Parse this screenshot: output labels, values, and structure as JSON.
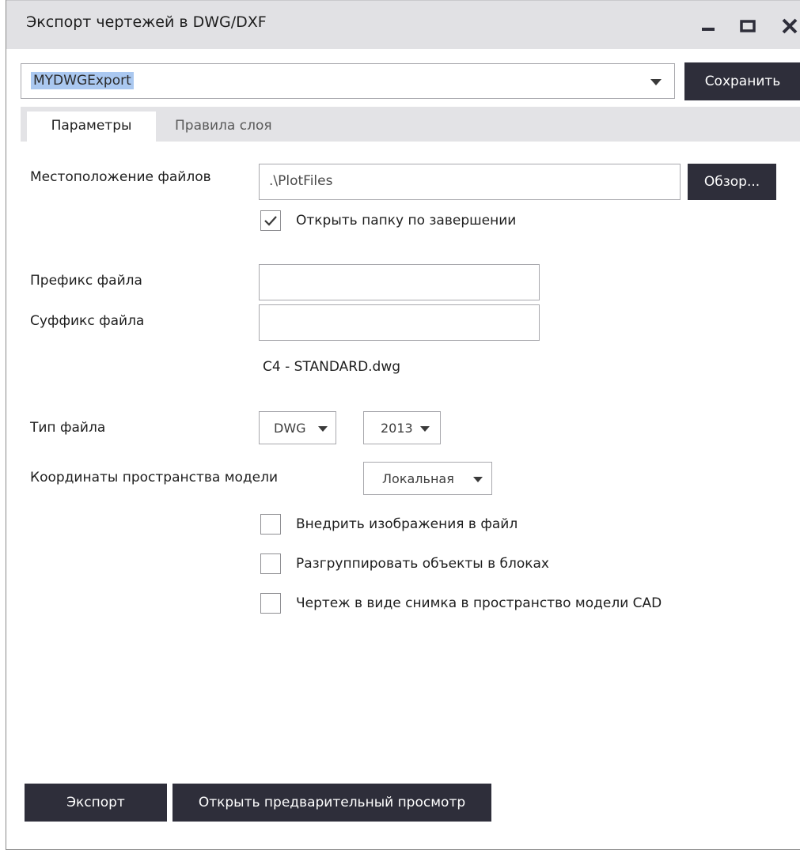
{
  "window": {
    "title": "Экспорт чертежей в DWG/DXF"
  },
  "profile": {
    "value": "MYDWGExport",
    "save_label": "Сохранить"
  },
  "tabs": [
    {
      "label": "Параметры"
    },
    {
      "label": "Правила слоя"
    }
  ],
  "file_location": {
    "label": "Местоположение файлов",
    "value": ".\\PlotFiles",
    "browse_label": "Обзор...",
    "open_folder_label": "Открыть папку по завершении",
    "open_folder_checked": true
  },
  "prefix": {
    "label": "Префикс файла",
    "value": ""
  },
  "suffix": {
    "label": "Суффикс файла",
    "value": ""
  },
  "filename_preview": "C4 - STANDARD.dwg",
  "file_type": {
    "label": "Тип файла",
    "format": "DWG",
    "version": "2013"
  },
  "model_coordinates": {
    "label": "Координаты пространства модели",
    "value": "Локальная"
  },
  "options": [
    {
      "label": "Внедрить изображения в файл",
      "checked": false
    },
    {
      "label": "Разгруппировать объекты в блоках",
      "checked": false
    },
    {
      "label": "Чертеж в виде снимка в пространство модели CAD",
      "checked": false
    }
  ],
  "actions": {
    "export_label": "Экспорт",
    "preview_label": "Открыть предварительный просмотр"
  },
  "colors": {
    "button_dark": "#2e2e3a",
    "titlebar": "#e1e1e4",
    "selection": "#aac8f0"
  }
}
